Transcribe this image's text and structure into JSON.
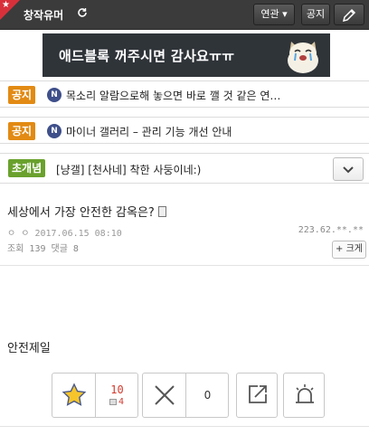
{
  "header": {
    "title": "창작유머",
    "related_label": "연관 ▾",
    "notice_label": "공지",
    "refresh_icon": "refresh-icon",
    "write_icon": "pencil-icon"
  },
  "banner": {
    "text": "애드블록 꺼주시면 감사요ㅠㅠ"
  },
  "notices": [
    {
      "tag": "공지",
      "badge": "N",
      "text": "목소리 알람으로해 놓으면 바로 깰 것 같은 연…"
    },
    {
      "tag": "공지",
      "badge": "N",
      "text": "마이너 갤러리 – 관리 기능 개선 안내"
    },
    {
      "tag": "초개념",
      "text": "[냥갤] [천사네] 착한 사둥이네:)"
    }
  ],
  "post": {
    "title": "세상에서 가장 안전한 감옥은?",
    "author_date": "ㅇ ㅇ 2017.06.15 08:10",
    "ip": "223.62.**.**",
    "stats": "조회 139 댓글 8",
    "bigger_label": "+ 크게",
    "body": "안전제일"
  },
  "votes": {
    "recommend_count": "10",
    "fixed_count": "4",
    "nonrecommend_count": "0"
  },
  "colors": {
    "header_bg": "#3b3b3b",
    "corner": "#d8303a",
    "notice_tag": "#e28a13",
    "concept_tag": "#6aa12d",
    "badge": "#3e4f8a",
    "recommend": "#d23b2f"
  }
}
